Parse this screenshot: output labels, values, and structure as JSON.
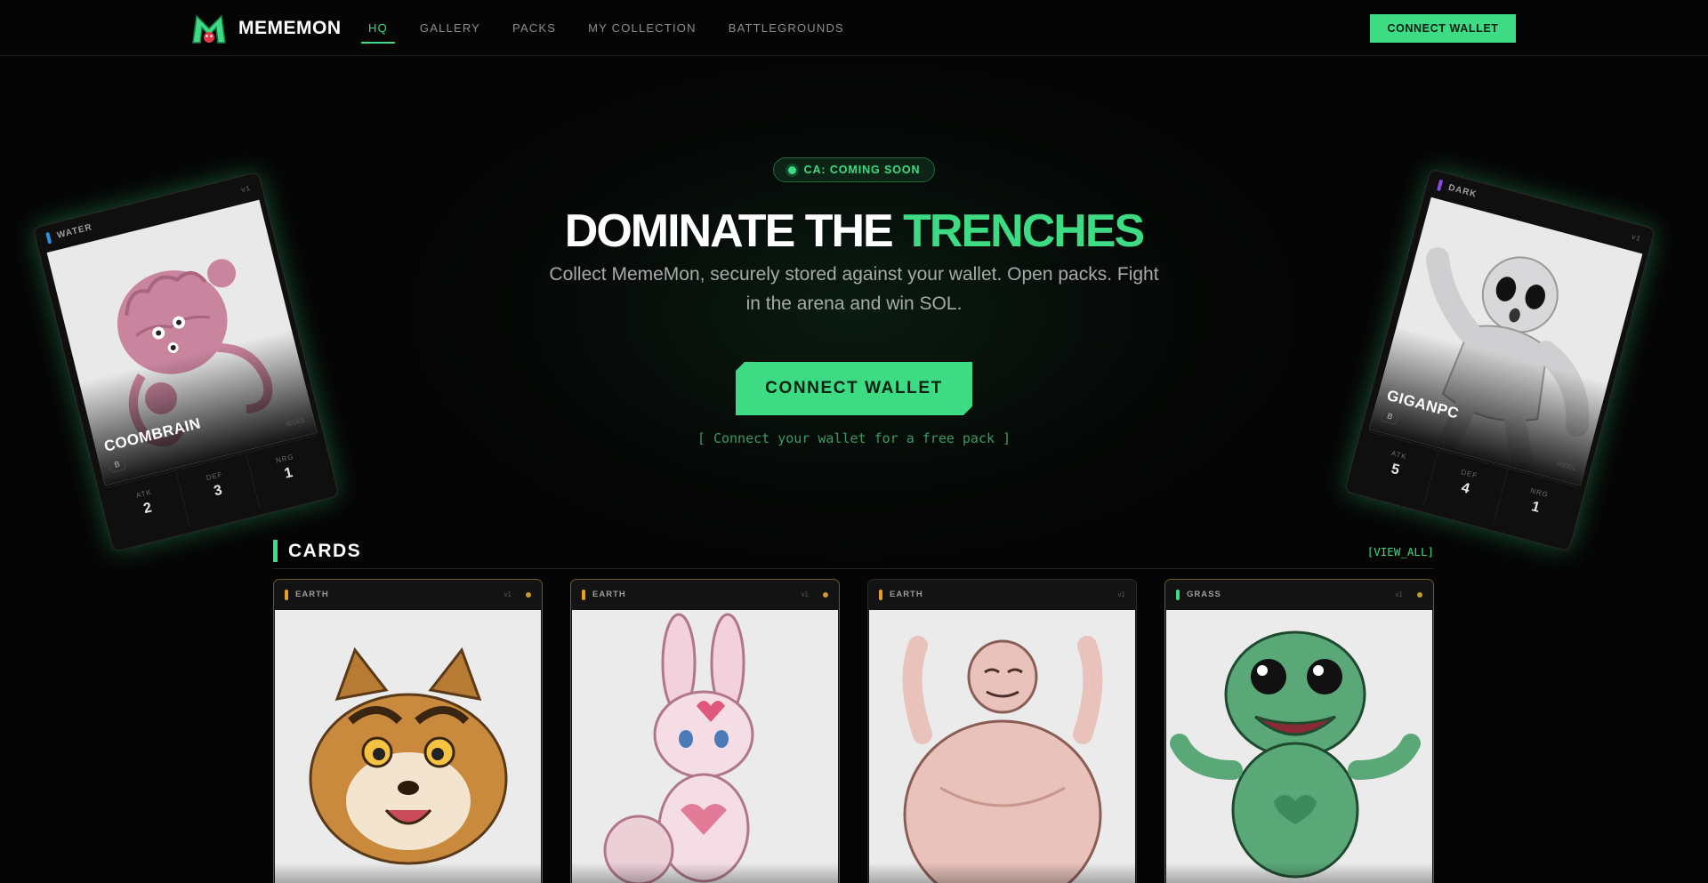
{
  "brand": {
    "name": "MEMEMON",
    "logo_icon": "m-monster-logo"
  },
  "nav": {
    "links": [
      {
        "label": "HQ",
        "active": true
      },
      {
        "label": "GALLERY",
        "active": false
      },
      {
        "label": "PACKS",
        "active": false
      },
      {
        "label": "MY COLLECTION",
        "active": false
      },
      {
        "label": "BATTLEGROUNDS",
        "active": false
      }
    ],
    "connect_label": "CONNECT WALLET"
  },
  "hero": {
    "badge": "CA: COMING SOON",
    "headline_main": "DOMINATE THE ",
    "headline_accent": "TRENCHES",
    "subtext": "Collect MemeMon, securely stored against your wallet. Open packs. Fight in the arena and win SOL.",
    "cta_label": "CONNECT WALLET",
    "cta_note": "[ Connect your wallet for a free pack ]"
  },
  "floating_cards": [
    {
      "type": "WATER",
      "type_color": "#2f8fe0",
      "version": "v1",
      "name": "COOMBRAIN",
      "rarity": "B",
      "serial": "#0001",
      "stats": [
        {
          "label": "ATK",
          "value": "2"
        },
        {
          "label": "DEF",
          "value": "3"
        },
        {
          "label": "NRG",
          "value": "1"
        }
      ]
    },
    {
      "type": "DARK",
      "type_color": "#8a4ce0",
      "version": "v1",
      "name": "GIGANPC",
      "rarity": "B",
      "serial": "#0001",
      "stats": [
        {
          "label": "ATK",
          "value": "5"
        },
        {
          "label": "DEF",
          "value": "4"
        },
        {
          "label": "NRG",
          "value": "1"
        }
      ]
    }
  ],
  "cards_section": {
    "title": "CARDS",
    "view_all": "[VIEW_ALL]",
    "cards": [
      {
        "type": "EARTH",
        "type_color": "#e8a020",
        "version": "v1",
        "featured": true
      },
      {
        "type": "EARTH",
        "type_color": "#e8a020",
        "version": "v1",
        "featured": true
      },
      {
        "type": "EARTH",
        "type_color": "#e8a020",
        "version": "v1",
        "featured": false
      },
      {
        "type": "GRASS",
        "type_color": "#3ddc84",
        "version": "v1",
        "featured": true
      }
    ]
  },
  "colors": {
    "accent": "#3ddc84",
    "background": "#050505"
  }
}
